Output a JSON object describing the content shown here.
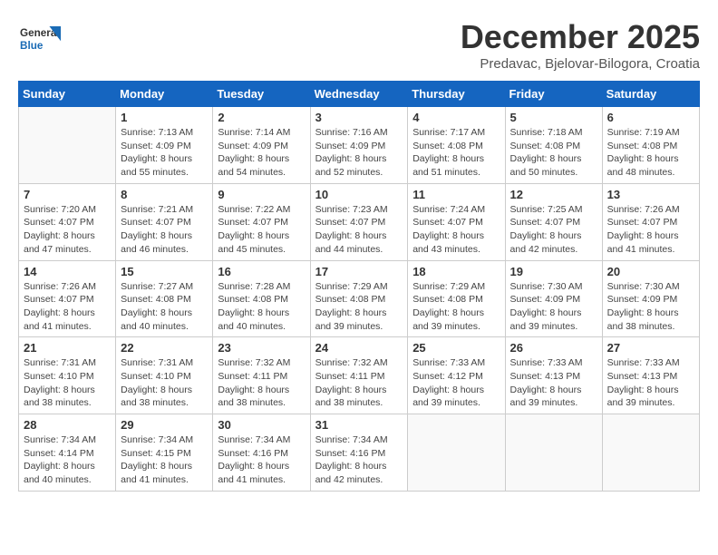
{
  "header": {
    "logo_general": "General",
    "logo_blue": "Blue",
    "month_title": "December 2025",
    "location": "Predavac, Bjelovar-Bilogora, Croatia"
  },
  "days_of_week": [
    "Sunday",
    "Monday",
    "Tuesday",
    "Wednesday",
    "Thursday",
    "Friday",
    "Saturday"
  ],
  "weeks": [
    [
      {
        "day": "",
        "info": ""
      },
      {
        "day": "1",
        "info": "Sunrise: 7:13 AM\nSunset: 4:09 PM\nDaylight: 8 hours\nand 55 minutes."
      },
      {
        "day": "2",
        "info": "Sunrise: 7:14 AM\nSunset: 4:09 PM\nDaylight: 8 hours\nand 54 minutes."
      },
      {
        "day": "3",
        "info": "Sunrise: 7:16 AM\nSunset: 4:09 PM\nDaylight: 8 hours\nand 52 minutes."
      },
      {
        "day": "4",
        "info": "Sunrise: 7:17 AM\nSunset: 4:08 PM\nDaylight: 8 hours\nand 51 minutes."
      },
      {
        "day": "5",
        "info": "Sunrise: 7:18 AM\nSunset: 4:08 PM\nDaylight: 8 hours\nand 50 minutes."
      },
      {
        "day": "6",
        "info": "Sunrise: 7:19 AM\nSunset: 4:08 PM\nDaylight: 8 hours\nand 48 minutes."
      }
    ],
    [
      {
        "day": "7",
        "info": "Sunrise: 7:20 AM\nSunset: 4:07 PM\nDaylight: 8 hours\nand 47 minutes."
      },
      {
        "day": "8",
        "info": "Sunrise: 7:21 AM\nSunset: 4:07 PM\nDaylight: 8 hours\nand 46 minutes."
      },
      {
        "day": "9",
        "info": "Sunrise: 7:22 AM\nSunset: 4:07 PM\nDaylight: 8 hours\nand 45 minutes."
      },
      {
        "day": "10",
        "info": "Sunrise: 7:23 AM\nSunset: 4:07 PM\nDaylight: 8 hours\nand 44 minutes."
      },
      {
        "day": "11",
        "info": "Sunrise: 7:24 AM\nSunset: 4:07 PM\nDaylight: 8 hours\nand 43 minutes."
      },
      {
        "day": "12",
        "info": "Sunrise: 7:25 AM\nSunset: 4:07 PM\nDaylight: 8 hours\nand 42 minutes."
      },
      {
        "day": "13",
        "info": "Sunrise: 7:26 AM\nSunset: 4:07 PM\nDaylight: 8 hours\nand 41 minutes."
      }
    ],
    [
      {
        "day": "14",
        "info": "Sunrise: 7:26 AM\nSunset: 4:07 PM\nDaylight: 8 hours\nand 41 minutes."
      },
      {
        "day": "15",
        "info": "Sunrise: 7:27 AM\nSunset: 4:08 PM\nDaylight: 8 hours\nand 40 minutes."
      },
      {
        "day": "16",
        "info": "Sunrise: 7:28 AM\nSunset: 4:08 PM\nDaylight: 8 hours\nand 40 minutes."
      },
      {
        "day": "17",
        "info": "Sunrise: 7:29 AM\nSunset: 4:08 PM\nDaylight: 8 hours\nand 39 minutes."
      },
      {
        "day": "18",
        "info": "Sunrise: 7:29 AM\nSunset: 4:08 PM\nDaylight: 8 hours\nand 39 minutes."
      },
      {
        "day": "19",
        "info": "Sunrise: 7:30 AM\nSunset: 4:09 PM\nDaylight: 8 hours\nand 39 minutes."
      },
      {
        "day": "20",
        "info": "Sunrise: 7:30 AM\nSunset: 4:09 PM\nDaylight: 8 hours\nand 38 minutes."
      }
    ],
    [
      {
        "day": "21",
        "info": "Sunrise: 7:31 AM\nSunset: 4:10 PM\nDaylight: 8 hours\nand 38 minutes."
      },
      {
        "day": "22",
        "info": "Sunrise: 7:31 AM\nSunset: 4:10 PM\nDaylight: 8 hours\nand 38 minutes."
      },
      {
        "day": "23",
        "info": "Sunrise: 7:32 AM\nSunset: 4:11 PM\nDaylight: 8 hours\nand 38 minutes."
      },
      {
        "day": "24",
        "info": "Sunrise: 7:32 AM\nSunset: 4:11 PM\nDaylight: 8 hours\nand 38 minutes."
      },
      {
        "day": "25",
        "info": "Sunrise: 7:33 AM\nSunset: 4:12 PM\nDaylight: 8 hours\nand 39 minutes."
      },
      {
        "day": "26",
        "info": "Sunrise: 7:33 AM\nSunset: 4:13 PM\nDaylight: 8 hours\nand 39 minutes."
      },
      {
        "day": "27",
        "info": "Sunrise: 7:33 AM\nSunset: 4:13 PM\nDaylight: 8 hours\nand 39 minutes."
      }
    ],
    [
      {
        "day": "28",
        "info": "Sunrise: 7:34 AM\nSunset: 4:14 PM\nDaylight: 8 hours\nand 40 minutes."
      },
      {
        "day": "29",
        "info": "Sunrise: 7:34 AM\nSunset: 4:15 PM\nDaylight: 8 hours\nand 41 minutes."
      },
      {
        "day": "30",
        "info": "Sunrise: 7:34 AM\nSunset: 4:16 PM\nDaylight: 8 hours\nand 41 minutes."
      },
      {
        "day": "31",
        "info": "Sunrise: 7:34 AM\nSunset: 4:16 PM\nDaylight: 8 hours\nand 42 minutes."
      },
      {
        "day": "",
        "info": ""
      },
      {
        "day": "",
        "info": ""
      },
      {
        "day": "",
        "info": ""
      }
    ]
  ]
}
